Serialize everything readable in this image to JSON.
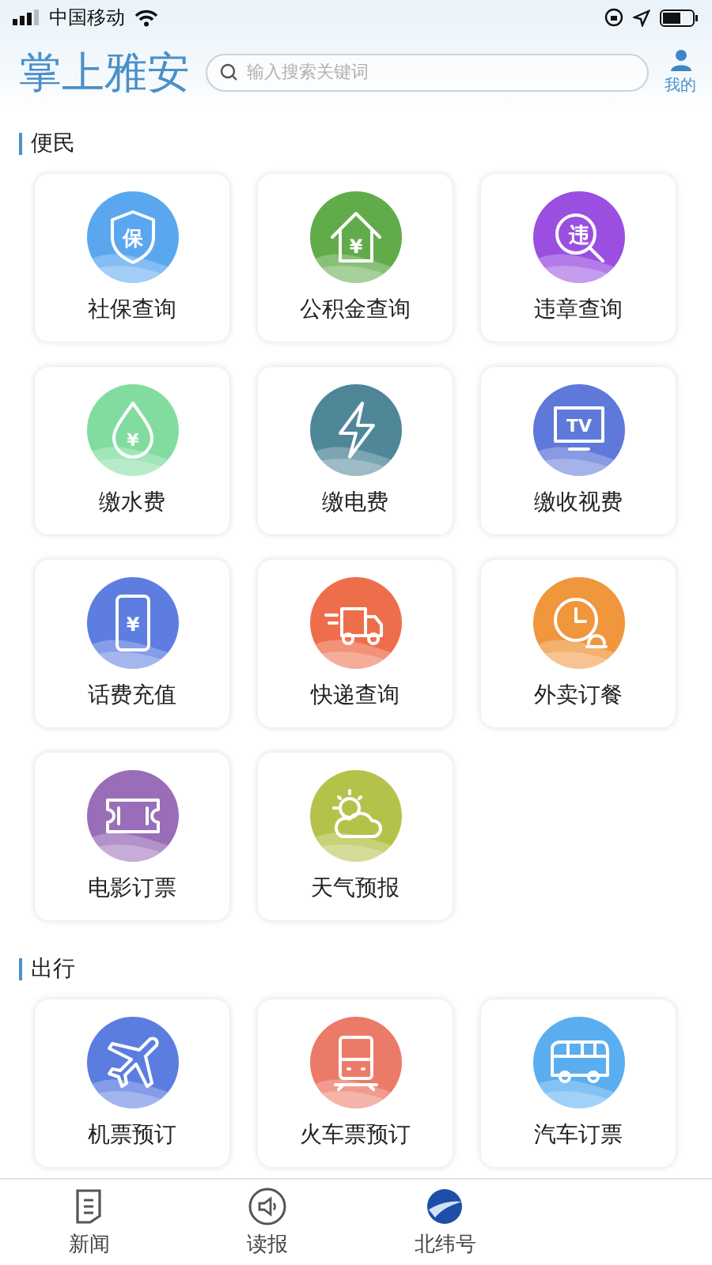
{
  "status_bar": {
    "carrier": "中国移动"
  },
  "header": {
    "title": "掌上雅安",
    "search": {
      "placeholder": "输入搜索关键词"
    },
    "profile": "我的"
  },
  "sections": [
    {
      "title": "便民",
      "tiles": [
        {
          "label": "社保查询",
          "color": "#5aa7ef",
          "glyph": "保"
        },
        {
          "label": "公积金查询",
          "color": "#62ab4a",
          "glyph": "¥"
        },
        {
          "label": "违章查询",
          "color": "#9a4fe0",
          "glyph": "违"
        },
        {
          "label": "缴水费",
          "color": "#82dca0",
          "glyph": "¥"
        },
        {
          "label": "缴电费",
          "color": "#4f8799"
        },
        {
          "label": "缴收视费",
          "color": "#5f79da",
          "glyph": "TV"
        },
        {
          "label": "话费充值",
          "color": "#5d7ee0",
          "glyph": "¥"
        },
        {
          "label": "快递查询",
          "color": "#ee6e4c"
        },
        {
          "label": "外卖订餐",
          "color": "#f0963c"
        },
        {
          "label": "电影订票",
          "color": "#9a6db8"
        },
        {
          "label": "天气预报",
          "color": "#b4c24a"
        }
      ]
    },
    {
      "title": "出行",
      "tiles": [
        {
          "label": "机票预订",
          "color": "#5c7de0"
        },
        {
          "label": "火车票预订",
          "color": "#ec7a68"
        },
        {
          "label": "汽车订票",
          "color": "#5aaef0"
        }
      ]
    }
  ],
  "tab_bar": [
    {
      "label": "新闻"
    },
    {
      "label": "读报"
    },
    {
      "label": "北纬号"
    }
  ]
}
